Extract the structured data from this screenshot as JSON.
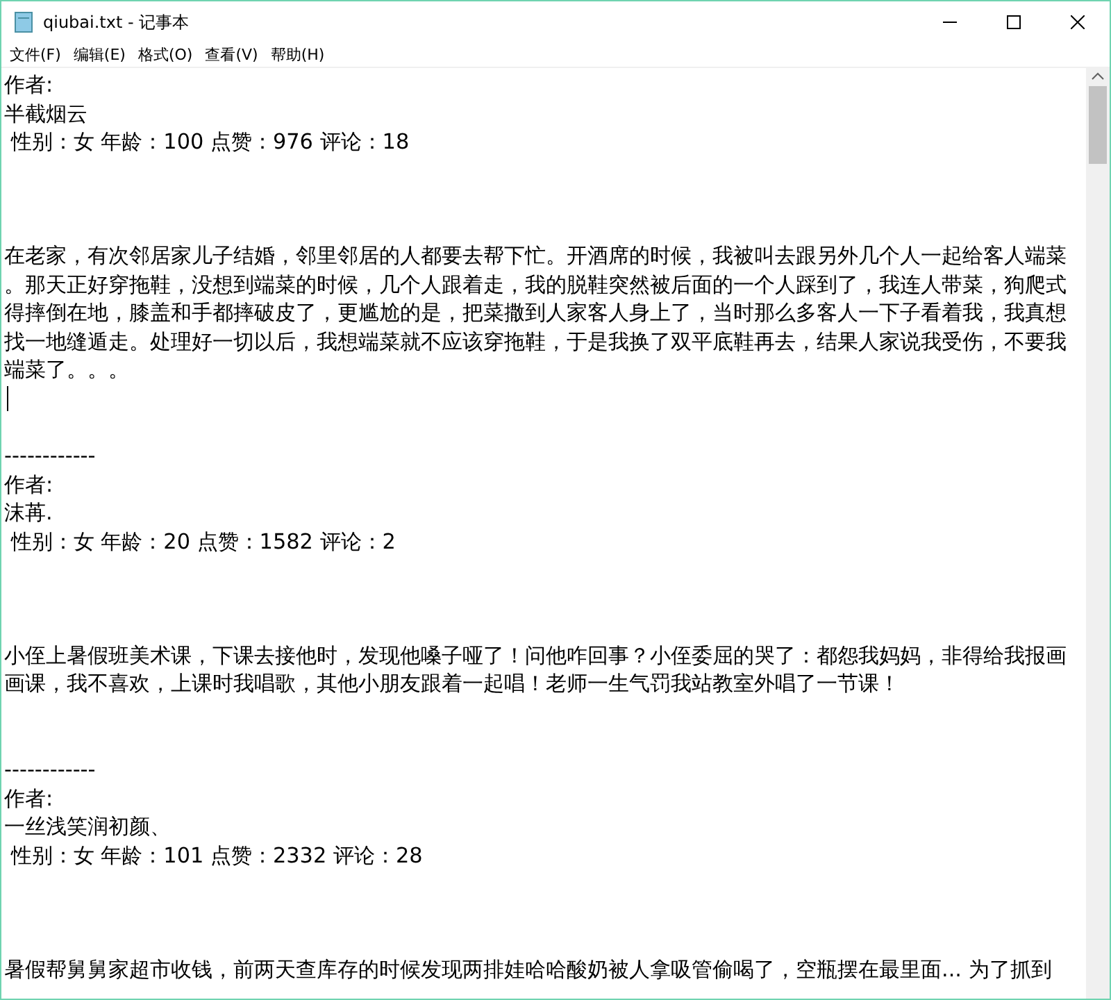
{
  "window": {
    "title": "qiubai.txt - 记事本"
  },
  "menu": [
    {
      "label": "文件(F)"
    },
    {
      "label": "编辑(E)"
    },
    {
      "label": "格式(O)"
    },
    {
      "label": "查看(V)"
    },
    {
      "label": "帮助(H)"
    }
  ],
  "document": {
    "lines": [
      {
        "kind": "text",
        "text": "作者:"
      },
      {
        "kind": "text",
        "text": "半截烟云"
      },
      {
        "kind": "text",
        "text": " 性别：女 年龄：100 点赞：976 评论：18"
      },
      {
        "kind": "blank"
      },
      {
        "kind": "blank"
      },
      {
        "kind": "blank"
      },
      {
        "kind": "text",
        "text": "在老家，有次邻居家儿子结婚，邻里邻居的人都要去帮下忙。开酒席的时候，我被叫去跟另外几个人一起给客人端菜"
      },
      {
        "kind": "text",
        "text": "。那天正好穿拖鞋，没想到端菜的时候，几个人跟着走，我的脱鞋突然被后面的一个人踩到了，我连人带菜，狗爬式"
      },
      {
        "kind": "text",
        "text": "得摔倒在地，膝盖和手都摔破皮了，更尴尬的是，把菜撒到人家客人身上了，当时那么多客人一下子看着我，我真想"
      },
      {
        "kind": "text",
        "text": "找一地缝遁走。处理好一切以后，我想端菜就不应该穿拖鞋，于是我换了双平底鞋再去，结果人家说我受伤，不要我"
      },
      {
        "kind": "text",
        "text": "端菜了。。。"
      },
      {
        "kind": "cursor"
      },
      {
        "kind": "blank"
      },
      {
        "kind": "text",
        "text": "------------"
      },
      {
        "kind": "text",
        "text": "作者:"
      },
      {
        "kind": "text",
        "text": "沫苒."
      },
      {
        "kind": "text",
        "text": " 性别：女 年龄：20 点赞：1582 评论：2"
      },
      {
        "kind": "blank"
      },
      {
        "kind": "blank"
      },
      {
        "kind": "blank"
      },
      {
        "kind": "text",
        "text": "小侄上暑假班美术课，下课去接他时，发现他嗓子哑了！问他咋回事？小侄委屈的哭了：都怨我妈妈，非得给我报画"
      },
      {
        "kind": "text",
        "text": "画课，我不喜欢，上课时我唱歌，其他小朋友跟着一起唱！老师一生气罚我站教室外唱了一节课！"
      },
      {
        "kind": "blank"
      },
      {
        "kind": "blank"
      },
      {
        "kind": "text",
        "text": "------------"
      },
      {
        "kind": "text",
        "text": "作者:"
      },
      {
        "kind": "text",
        "text": "一丝浅笑润初颜、"
      },
      {
        "kind": "text",
        "text": " 性别：女 年龄：101 点赞：2332 评论：28"
      },
      {
        "kind": "blank"
      },
      {
        "kind": "blank"
      },
      {
        "kind": "blank"
      },
      {
        "kind": "text",
        "text": "暑假帮舅舅家超市收钱，前两天查库存的时候发现两排娃哈哈酸奶被人拿吸管偷喝了，空瓶摆在最里面... 为了抓到"
      }
    ]
  }
}
